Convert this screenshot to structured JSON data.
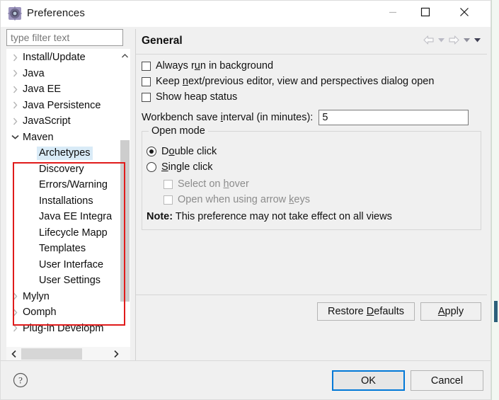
{
  "window": {
    "title": "Preferences",
    "icon": "preferences-gear-icon",
    "controls": {
      "minimize": "minimize-icon",
      "maximize": "maximize-icon",
      "close": "close-icon"
    }
  },
  "filter": {
    "placeholder": "type filter text",
    "value": ""
  },
  "tree": {
    "items": [
      {
        "label": "Install/Update",
        "level": 1,
        "state": "collapsed",
        "selected": false
      },
      {
        "label": "Java",
        "level": 1,
        "state": "collapsed",
        "selected": false
      },
      {
        "label": "Java EE",
        "level": 1,
        "state": "collapsed",
        "selected": false
      },
      {
        "label": "Java Persistence",
        "level": 1,
        "state": "collapsed",
        "selected": false
      },
      {
        "label": "JavaScript",
        "level": 1,
        "state": "collapsed",
        "selected": false
      },
      {
        "label": "Maven",
        "level": 1,
        "state": "expanded",
        "selected": false
      },
      {
        "label": "Archetypes",
        "level": 2,
        "state": "leaf",
        "selected": true
      },
      {
        "label": "Discovery",
        "level": 2,
        "state": "leaf",
        "selected": false
      },
      {
        "label": "Errors/Warning",
        "level": 2,
        "state": "leaf",
        "selected": false
      },
      {
        "label": "Installations",
        "level": 2,
        "state": "leaf",
        "selected": false
      },
      {
        "label": "Java EE Integra",
        "level": 2,
        "state": "leaf",
        "selected": false
      },
      {
        "label": "Lifecycle Mapp",
        "level": 2,
        "state": "leaf",
        "selected": false
      },
      {
        "label": "Templates",
        "level": 2,
        "state": "leaf",
        "selected": false
      },
      {
        "label": "User Interface",
        "level": 2,
        "state": "leaf",
        "selected": false
      },
      {
        "label": "User Settings",
        "level": 2,
        "state": "leaf",
        "selected": false
      },
      {
        "label": "Mylyn",
        "level": 1,
        "state": "collapsed",
        "selected": false
      },
      {
        "label": "Oomph",
        "level": 1,
        "state": "collapsed",
        "selected": false
      },
      {
        "label": "Plug-in Developm",
        "level": 1,
        "state": "collapsed",
        "selected": false
      }
    ],
    "scroll_up_icon": "chevron-up-icon",
    "scroll_down_icon": "chevron-down-icon",
    "scroll_left_icon": "chevron-left-icon",
    "scroll_right_icon": "chevron-right-icon"
  },
  "annotation": {
    "color": "#e01b1b",
    "shape": "rectangle"
  },
  "pane": {
    "title": "General",
    "nav": {
      "back_icon": "back-arrow-icon",
      "back_menu_icon": "chevron-down-icon",
      "forward_icon": "forward-arrow-icon",
      "forward_menu_icon": "chevron-down-icon",
      "view_menu_icon": "chevron-down-icon"
    },
    "checkboxes": [
      {
        "pre": "Always r",
        "mnemonic": "u",
        "post": "n in background",
        "checked": false,
        "enabled": true
      },
      {
        "pre": "Keep ",
        "mnemonic": "n",
        "post": "ext/previous editor, view and perspectives dialog open",
        "checked": false,
        "enabled": true
      },
      {
        "pre": "Show heap status",
        "mnemonic": "",
        "post": "",
        "checked": false,
        "enabled": true
      }
    ],
    "save_interval": {
      "pre": "Workbench save ",
      "mnemonic": "i",
      "post": "nterval (in minutes):",
      "value": "5"
    },
    "open_mode": {
      "legend": "Open mode",
      "radios": [
        {
          "pre": "D",
          "mnemonic": "o",
          "post": "uble click",
          "selected": true,
          "enabled": true
        },
        {
          "pre": "",
          "mnemonic": "S",
          "post": "ingle click",
          "selected": false,
          "enabled": true
        }
      ],
      "sub_checkboxes": [
        {
          "pre": "Select on ",
          "mnemonic": "h",
          "post": "over",
          "checked": false,
          "enabled": false
        },
        {
          "pre": "Open when using arrow ",
          "mnemonic": "k",
          "post": "eys",
          "checked": false,
          "enabled": false
        }
      ],
      "note_label": "Note:",
      "note_text": "This preference may not take effect on all views"
    },
    "buttons": {
      "restore_pre": "Restore ",
      "restore_mnemonic": "D",
      "restore_post": "efaults",
      "apply_mnemonic": "A",
      "apply_post": "pply"
    }
  },
  "footer": {
    "help_icon": "help-question-icon",
    "ok_label": "OK",
    "cancel_label": "Cancel"
  }
}
